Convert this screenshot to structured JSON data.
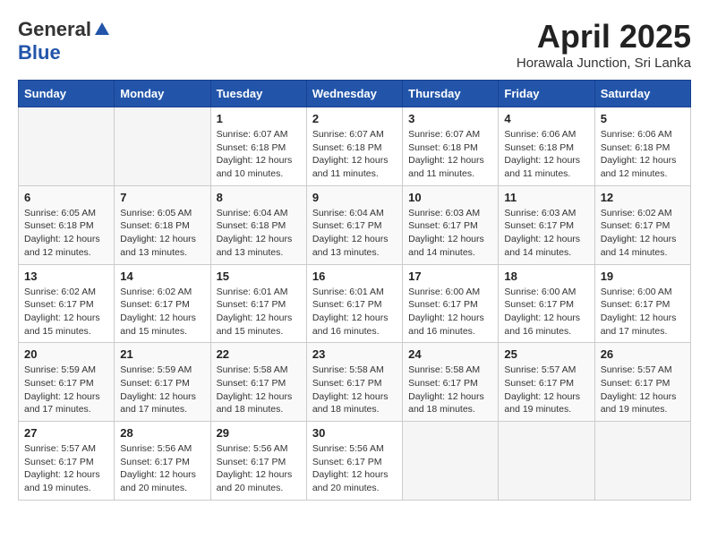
{
  "logo": {
    "general": "General",
    "blue": "Blue"
  },
  "title": "April 2025",
  "subtitle": "Horawala Junction, Sri Lanka",
  "days_of_week": [
    "Sunday",
    "Monday",
    "Tuesday",
    "Wednesday",
    "Thursday",
    "Friday",
    "Saturday"
  ],
  "weeks": [
    [
      {
        "day": "",
        "info": ""
      },
      {
        "day": "",
        "info": ""
      },
      {
        "day": "1",
        "info": "Sunrise: 6:07 AM\nSunset: 6:18 PM\nDaylight: 12 hours and 10 minutes."
      },
      {
        "day": "2",
        "info": "Sunrise: 6:07 AM\nSunset: 6:18 PM\nDaylight: 12 hours and 11 minutes."
      },
      {
        "day": "3",
        "info": "Sunrise: 6:07 AM\nSunset: 6:18 PM\nDaylight: 12 hours and 11 minutes."
      },
      {
        "day": "4",
        "info": "Sunrise: 6:06 AM\nSunset: 6:18 PM\nDaylight: 12 hours and 11 minutes."
      },
      {
        "day": "5",
        "info": "Sunrise: 6:06 AM\nSunset: 6:18 PM\nDaylight: 12 hours and 12 minutes."
      }
    ],
    [
      {
        "day": "6",
        "info": "Sunrise: 6:05 AM\nSunset: 6:18 PM\nDaylight: 12 hours and 12 minutes."
      },
      {
        "day": "7",
        "info": "Sunrise: 6:05 AM\nSunset: 6:18 PM\nDaylight: 12 hours and 13 minutes."
      },
      {
        "day": "8",
        "info": "Sunrise: 6:04 AM\nSunset: 6:18 PM\nDaylight: 12 hours and 13 minutes."
      },
      {
        "day": "9",
        "info": "Sunrise: 6:04 AM\nSunset: 6:17 PM\nDaylight: 12 hours and 13 minutes."
      },
      {
        "day": "10",
        "info": "Sunrise: 6:03 AM\nSunset: 6:17 PM\nDaylight: 12 hours and 14 minutes."
      },
      {
        "day": "11",
        "info": "Sunrise: 6:03 AM\nSunset: 6:17 PM\nDaylight: 12 hours and 14 minutes."
      },
      {
        "day": "12",
        "info": "Sunrise: 6:02 AM\nSunset: 6:17 PM\nDaylight: 12 hours and 14 minutes."
      }
    ],
    [
      {
        "day": "13",
        "info": "Sunrise: 6:02 AM\nSunset: 6:17 PM\nDaylight: 12 hours and 15 minutes."
      },
      {
        "day": "14",
        "info": "Sunrise: 6:02 AM\nSunset: 6:17 PM\nDaylight: 12 hours and 15 minutes."
      },
      {
        "day": "15",
        "info": "Sunrise: 6:01 AM\nSunset: 6:17 PM\nDaylight: 12 hours and 15 minutes."
      },
      {
        "day": "16",
        "info": "Sunrise: 6:01 AM\nSunset: 6:17 PM\nDaylight: 12 hours and 16 minutes."
      },
      {
        "day": "17",
        "info": "Sunrise: 6:00 AM\nSunset: 6:17 PM\nDaylight: 12 hours and 16 minutes."
      },
      {
        "day": "18",
        "info": "Sunrise: 6:00 AM\nSunset: 6:17 PM\nDaylight: 12 hours and 16 minutes."
      },
      {
        "day": "19",
        "info": "Sunrise: 6:00 AM\nSunset: 6:17 PM\nDaylight: 12 hours and 17 minutes."
      }
    ],
    [
      {
        "day": "20",
        "info": "Sunrise: 5:59 AM\nSunset: 6:17 PM\nDaylight: 12 hours and 17 minutes."
      },
      {
        "day": "21",
        "info": "Sunrise: 5:59 AM\nSunset: 6:17 PM\nDaylight: 12 hours and 17 minutes."
      },
      {
        "day": "22",
        "info": "Sunrise: 5:58 AM\nSunset: 6:17 PM\nDaylight: 12 hours and 18 minutes."
      },
      {
        "day": "23",
        "info": "Sunrise: 5:58 AM\nSunset: 6:17 PM\nDaylight: 12 hours and 18 minutes."
      },
      {
        "day": "24",
        "info": "Sunrise: 5:58 AM\nSunset: 6:17 PM\nDaylight: 12 hours and 18 minutes."
      },
      {
        "day": "25",
        "info": "Sunrise: 5:57 AM\nSunset: 6:17 PM\nDaylight: 12 hours and 19 minutes."
      },
      {
        "day": "26",
        "info": "Sunrise: 5:57 AM\nSunset: 6:17 PM\nDaylight: 12 hours and 19 minutes."
      }
    ],
    [
      {
        "day": "27",
        "info": "Sunrise: 5:57 AM\nSunset: 6:17 PM\nDaylight: 12 hours and 19 minutes."
      },
      {
        "day": "28",
        "info": "Sunrise: 5:56 AM\nSunset: 6:17 PM\nDaylight: 12 hours and 20 minutes."
      },
      {
        "day": "29",
        "info": "Sunrise: 5:56 AM\nSunset: 6:17 PM\nDaylight: 12 hours and 20 minutes."
      },
      {
        "day": "30",
        "info": "Sunrise: 5:56 AM\nSunset: 6:17 PM\nDaylight: 12 hours and 20 minutes."
      },
      {
        "day": "",
        "info": ""
      },
      {
        "day": "",
        "info": ""
      },
      {
        "day": "",
        "info": ""
      }
    ]
  ]
}
